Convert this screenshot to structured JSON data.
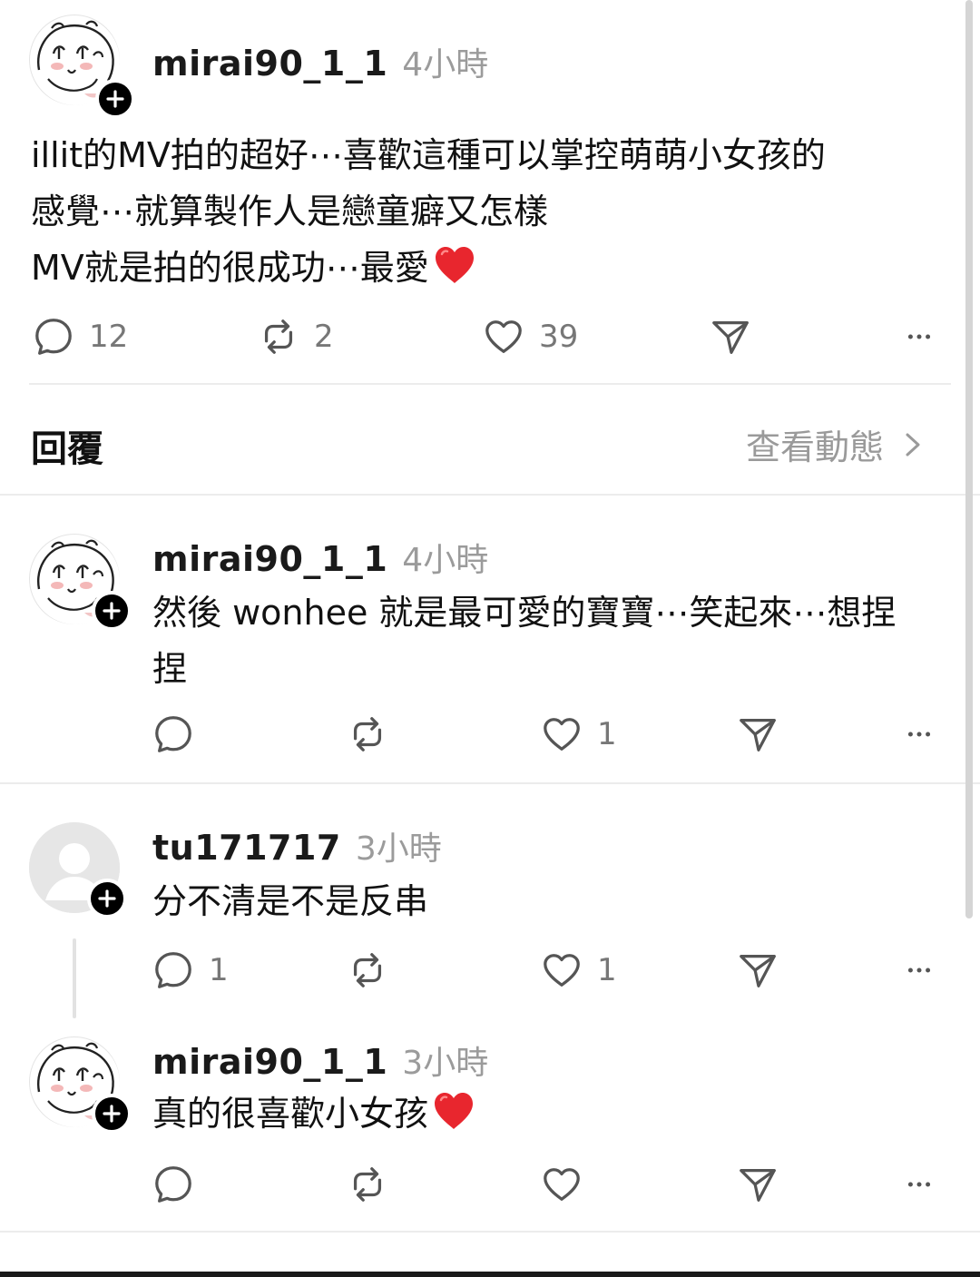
{
  "main_post": {
    "username": "mirai90_1_1",
    "time": "4小時",
    "lines": [
      "illit的MV拍的超好⋯喜歡這種可以掌控萌萌小女孩的",
      "感覺⋯就算製作人是戀童癖又怎樣",
      "MV就是拍的很成功⋯最愛"
    ],
    "reply_count": "12",
    "repost_count": "2",
    "like_count": "39"
  },
  "replies_section": {
    "title": "回覆",
    "activity_link": "查看動態"
  },
  "replies": [
    {
      "username": "mirai90_1_1",
      "time": "4小時",
      "lines": [
        "然後 wonhee 就是最可愛的寶寶⋯笑起來⋯想捏",
        "捏"
      ],
      "reply_count": "",
      "repost_count": "",
      "like_count": "1"
    },
    {
      "username": "tu171717",
      "time": "3小時",
      "lines": [
        "分不清是不是反串"
      ],
      "reply_count": "1",
      "repost_count": "",
      "like_count": "1"
    },
    {
      "username": "mirai90_1_1",
      "time": "3小時",
      "lines": [
        "真的很喜歡小女孩"
      ],
      "reply_count": "",
      "repost_count": "",
      "like_count": ""
    }
  ],
  "icons": {
    "reply": "speech-bubble-icon",
    "repost": "repost-arrows-icon",
    "like": "heart-outline-icon",
    "share": "send-arrow-icon",
    "more": "ellipsis-icon",
    "follow": "plus-icon",
    "emoji": "red-heart-emoji"
  },
  "colors": {
    "emoji_heart": "#e8262e",
    "muted_text": "#9b9b9b",
    "icon_stroke": "#555555"
  }
}
